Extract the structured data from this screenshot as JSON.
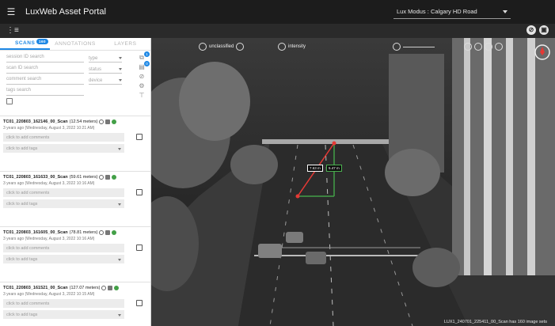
{
  "app": {
    "title": "LuxWeb Asset Portal",
    "project": "Lux Modus : Calgary HD Road"
  },
  "tabs": {
    "scans": "SCANS",
    "scans_badge": "160",
    "annotations": "ANNOTATIONS",
    "layers": "LAYERS"
  },
  "filters": {
    "session_id": "session ID search",
    "type": "type",
    "scan_id": "scan ID search",
    "status": "status",
    "comment": "comment search",
    "device": "device",
    "tags": "tags search"
  },
  "side_badges": {
    "first": "1",
    "second": "0"
  },
  "scans": [
    {
      "name": "TC01_220803_162146_00_Scan",
      "length": "(12.54 meters)",
      "date": "3 years ago (Wednesday, August 3, 2022 10:21 AM)",
      "comments": "click to add comments",
      "tags": "click to add tags"
    },
    {
      "name": "TC01_220803_161633_00_Scan",
      "length": "(59.61 meters)",
      "date": "3 years ago (Wednesday, August 3, 2022 10:16 AM)",
      "comments": "click to add comments",
      "tags": "click to add tags"
    },
    {
      "name": "TC01_220803_161605_00_Scan",
      "length": "(78.81 meters)",
      "date": "3 years ago (Wednesday, August 3, 2022 10:16 AM)",
      "comments": "click to add comments",
      "tags": "click to add tags"
    },
    {
      "name": "TC01_220803_161521_00_Scan",
      "length": "(127.07 meters)",
      "date": "3 years ago (Wednesday, August 3, 2022 10:15 AM)",
      "comments": "click to add comments",
      "tags": "click to add tags"
    }
  ],
  "map": {
    "unclassified": "unclassified",
    "intensity": "intensity",
    "measure_1": "7.63 m",
    "measure_2": "5.47 m",
    "status": "LUX1_240701_225411_00_Scan has 160 image sets"
  },
  "colors": {
    "accent": "#1e88e5",
    "ok": "#43a047",
    "measure_line": "#e53935"
  }
}
